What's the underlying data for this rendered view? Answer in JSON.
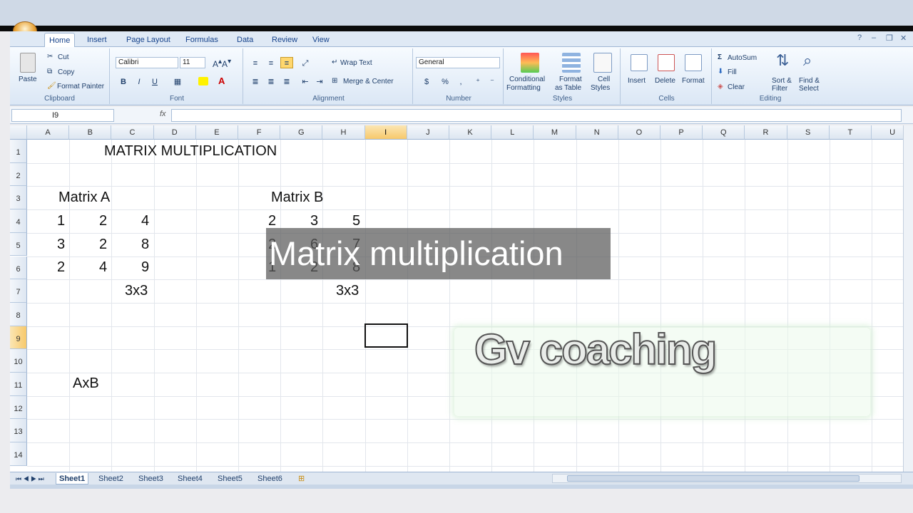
{
  "ribbon_tabs": [
    "Home",
    "Insert",
    "Page Layout",
    "Formulas",
    "Data",
    "Review",
    "View"
  ],
  "clipboard": {
    "paste": "Paste",
    "cut": "Cut",
    "copy": "Copy",
    "format_painter": "Format Painter",
    "label": "Clipboard"
  },
  "font": {
    "name": "Calibri",
    "size": "11",
    "bold": "B",
    "italic": "I",
    "underline": "U",
    "label": "Font"
  },
  "alignment": {
    "wrap_text": "Wrap Text",
    "merge_center": "Merge & Center",
    "label": "Alignment"
  },
  "number": {
    "format": "General",
    "percent": "%",
    "comma": ",",
    "label": "Number"
  },
  "styles": {
    "conditional": "Conditional",
    "conditional2": "Formatting",
    "format_table": "Format",
    "format_table2": "as Table",
    "cell_styles": "Cell",
    "cell_styles2": "Styles",
    "label": "Styles"
  },
  "cells": {
    "insert": "Insert",
    "delete": "Delete",
    "format": "Format",
    "label": "Cells"
  },
  "editing": {
    "autosum": "AutoSum",
    "fill": "Fill",
    "clear": "Clear",
    "sort": "Sort &",
    "sort2": "Filter",
    "find": "Find &",
    "find2": "Select",
    "label": "Editing"
  },
  "formula_bar": {
    "name_box": "I9",
    "fx": "fx",
    "value": ""
  },
  "columns": [
    "A",
    "B",
    "C",
    "D",
    "E",
    "F",
    "G",
    "H",
    "I",
    "J",
    "K",
    "L",
    "M",
    "N",
    "O",
    "P",
    "Q",
    "R",
    "S",
    "T",
    "U"
  ],
  "selected_column": "I",
  "rows": [
    "1",
    "2",
    "3",
    "4",
    "5",
    "6",
    "7",
    "8",
    "9",
    "10",
    "11",
    "12",
    "13",
    "14"
  ],
  "selected_row": "9",
  "cells_data": {
    "title": "MATRIX MULTIPLICATION",
    "matrix_a_label": "Matrix  A",
    "matrix_b_label": "Matrix B",
    "matrix_a": [
      [
        "1",
        "2",
        "4"
      ],
      [
        "3",
        "2",
        "8"
      ],
      [
        "2",
        "4",
        "9"
      ]
    ],
    "matrix_b": [
      [
        "2",
        "3",
        "5"
      ],
      [
        "2",
        "6",
        "7"
      ],
      [
        "1",
        "2",
        "8"
      ]
    ],
    "dim_a": "3x3",
    "dim_b": "3x3",
    "product_label": "AxB"
  },
  "sheet_tabs": [
    "Sheet1",
    "Sheet2",
    "Sheet3",
    "Sheet4",
    "Sheet5",
    "Sheet6"
  ],
  "active_sheet": "Sheet1",
  "overlay": {
    "caption": "Matrix multiplication",
    "watermark": "Gv coaching"
  }
}
